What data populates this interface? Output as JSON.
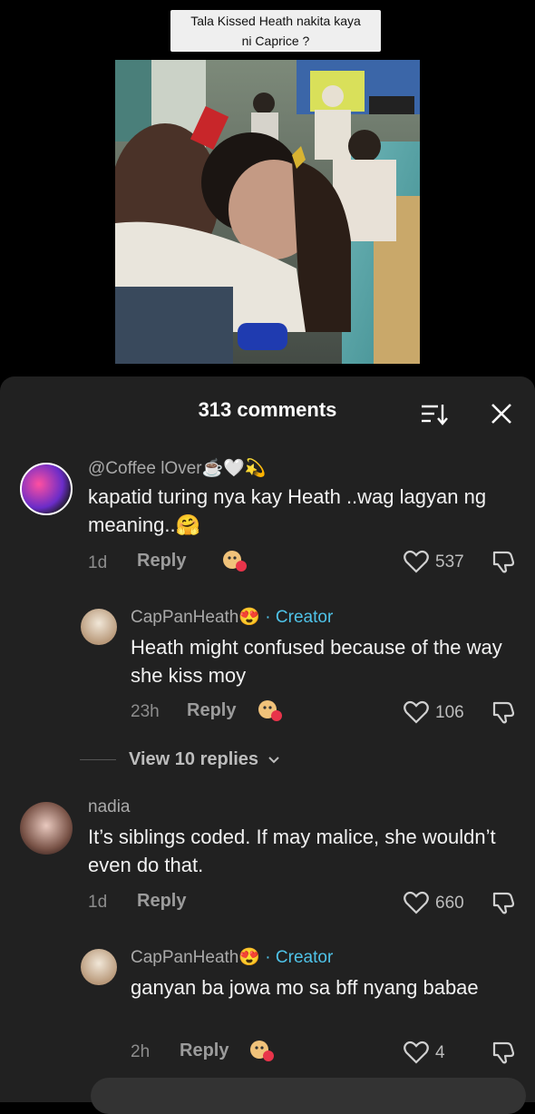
{
  "video": {
    "caption_line1": "Tala Kissed Heath nakita kaya",
    "caption_line2": "ni Caprice ?"
  },
  "comments_header": {
    "title": "313 comments",
    "sort_icon": "sort-icon",
    "close_icon": "close-icon"
  },
  "comments": [
    {
      "username": "@Coffee lOver☕🤍💫",
      "text": "kapatid turing nya kay Heath ..wag lagyan ng meaning..🤗",
      "time": "1d",
      "reply_label": "Reply",
      "likes": "537"
    },
    {
      "username": "CapPanHeath😍",
      "badge": " · Creator",
      "text": "Heath might confused because of the way she kiss moy",
      "time": "23h",
      "reply_label": "Reply",
      "likes": "106"
    },
    {
      "username": "nadia",
      "text": "It’s siblings coded. If may malice, she wouldn’t even do that.",
      "time": "1d",
      "reply_label": "Reply",
      "likes": "660"
    },
    {
      "username": "CapPanHeath😍",
      "badge": " · Creator",
      "text": "ganyan ba jowa mo sa bff nyang babae",
      "time": "2h",
      "reply_label": "Reply",
      "likes": "4"
    }
  ],
  "view_replies": "View 10 replies",
  "colors": {
    "sheet": "#212121",
    "creator": "#4fc3e8",
    "muted": "#8d8d8d"
  }
}
